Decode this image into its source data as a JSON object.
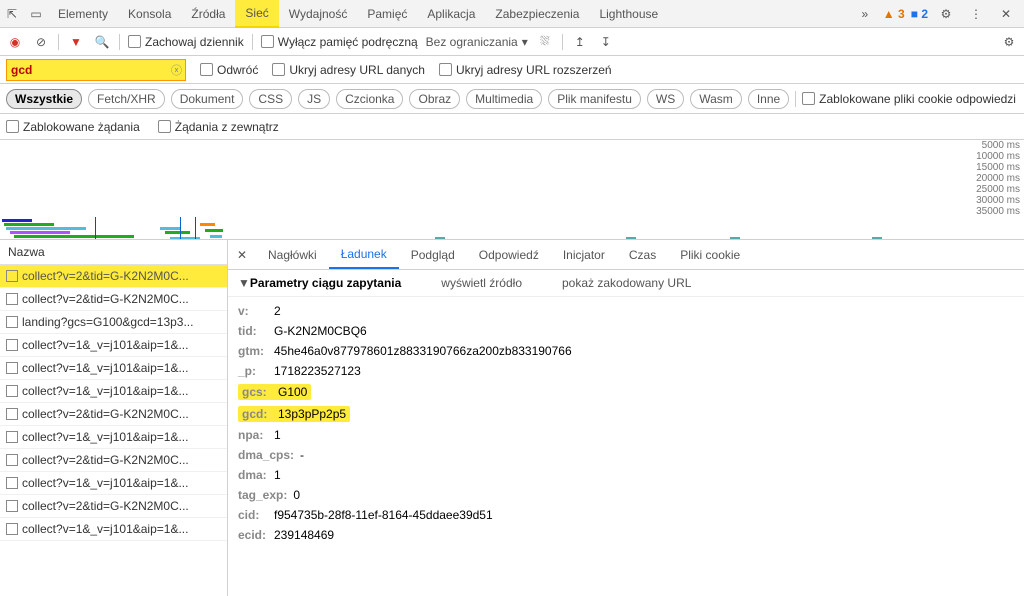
{
  "tabs": [
    "Elementy",
    "Konsola",
    "Źródła",
    "Sieć",
    "Wydajność",
    "Pamięć",
    "Aplikacja",
    "Zabezpieczenia",
    "Lighthouse"
  ],
  "active_tab": 3,
  "warn_count": "3",
  "info_count": "2",
  "toolbar": {
    "preserve_log": "Zachowaj dziennik",
    "disable_cache": "Wyłącz pamięć podręczną",
    "throttle": "Bez ograniczania"
  },
  "filter": {
    "value": "gcd",
    "invert": "Odwróć",
    "hide_data": "Ukryj adresy URL danych",
    "hide_ext": "Ukryj adresy URL rozszerzeń"
  },
  "types": [
    "Wszystkie",
    "Fetch/XHR",
    "Dokument",
    "CSS",
    "JS",
    "Czcionka",
    "Obraz",
    "Multimedia",
    "Plik manifestu",
    "WS",
    "Wasm",
    "Inne"
  ],
  "blocked_cookies": "Zablokowane pliki cookie odpowiedzi",
  "blocked_req": "Zablokowane żądania",
  "third_party": "Żądania z zewnątrz",
  "timeline_ticks": [
    "5000 ms",
    "10000 ms",
    "15000 ms",
    "20000 ms",
    "25000 ms",
    "30000 ms",
    "35000 ms"
  ],
  "list_header": "Nazwa",
  "requests": [
    {
      "name": "collect?v=2&tid=G-K2N2M0C...",
      "sel": true
    },
    {
      "name": "collect?v=2&tid=G-K2N2M0C...",
      "sel": false
    },
    {
      "name": "landing?gcs=G100&gcd=13p3...",
      "sel": false
    },
    {
      "name": "collect?v=1&_v=j101&aip=1&...",
      "sel": false
    },
    {
      "name": "collect?v=1&_v=j101&aip=1&...",
      "sel": false
    },
    {
      "name": "collect?v=1&_v=j101&aip=1&...",
      "sel": false
    },
    {
      "name": "collect?v=2&tid=G-K2N2M0C...",
      "sel": false
    },
    {
      "name": "collect?v=1&_v=j101&aip=1&...",
      "sel": false
    },
    {
      "name": "collect?v=2&tid=G-K2N2M0C...",
      "sel": false
    },
    {
      "name": "collect?v=1&_v=j101&aip=1&...",
      "sel": false
    },
    {
      "name": "collect?v=2&tid=G-K2N2M0C...",
      "sel": false
    },
    {
      "name": "collect?v=1&_v=j101&aip=1&...",
      "sel": false
    }
  ],
  "detail_tabs": [
    "Nagłówki",
    "Ładunek",
    "Podgląd",
    "Odpowiedź",
    "Inicjator",
    "Czas",
    "Pliki cookie"
  ],
  "detail_active": 1,
  "section_title": "Parametry ciągu zapytania",
  "view_source": "wyświetl źródło",
  "view_encoded": "pokaż zakodowany URL",
  "params": [
    {
      "k": "v:",
      "v": "2",
      "hl": false
    },
    {
      "k": "tid:",
      "v": "G-K2N2M0CBQ6",
      "hl": false
    },
    {
      "k": "gtm:",
      "v": "45he46a0v877978601z8833190766za200zb833190766",
      "hl": false
    },
    {
      "k": "_p:",
      "v": "1718223527123",
      "hl": false
    },
    {
      "k": "gcs:",
      "v": "G100",
      "hl": true
    },
    {
      "k": "gcd:",
      "v": "13p3pPp2p5",
      "hl": true
    },
    {
      "k": "npa:",
      "v": "1",
      "hl": false
    },
    {
      "k": "dma_cps:",
      "v": "-",
      "hl": false
    },
    {
      "k": "dma:",
      "v": "1",
      "hl": false
    },
    {
      "k": "tag_exp:",
      "v": "0",
      "hl": false
    },
    {
      "k": "cid:",
      "v": "f954735b-28f8-11ef-8164-45ddaee39d51",
      "hl": false
    },
    {
      "k": "ecid:",
      "v": "239148469",
      "hl": false
    }
  ]
}
